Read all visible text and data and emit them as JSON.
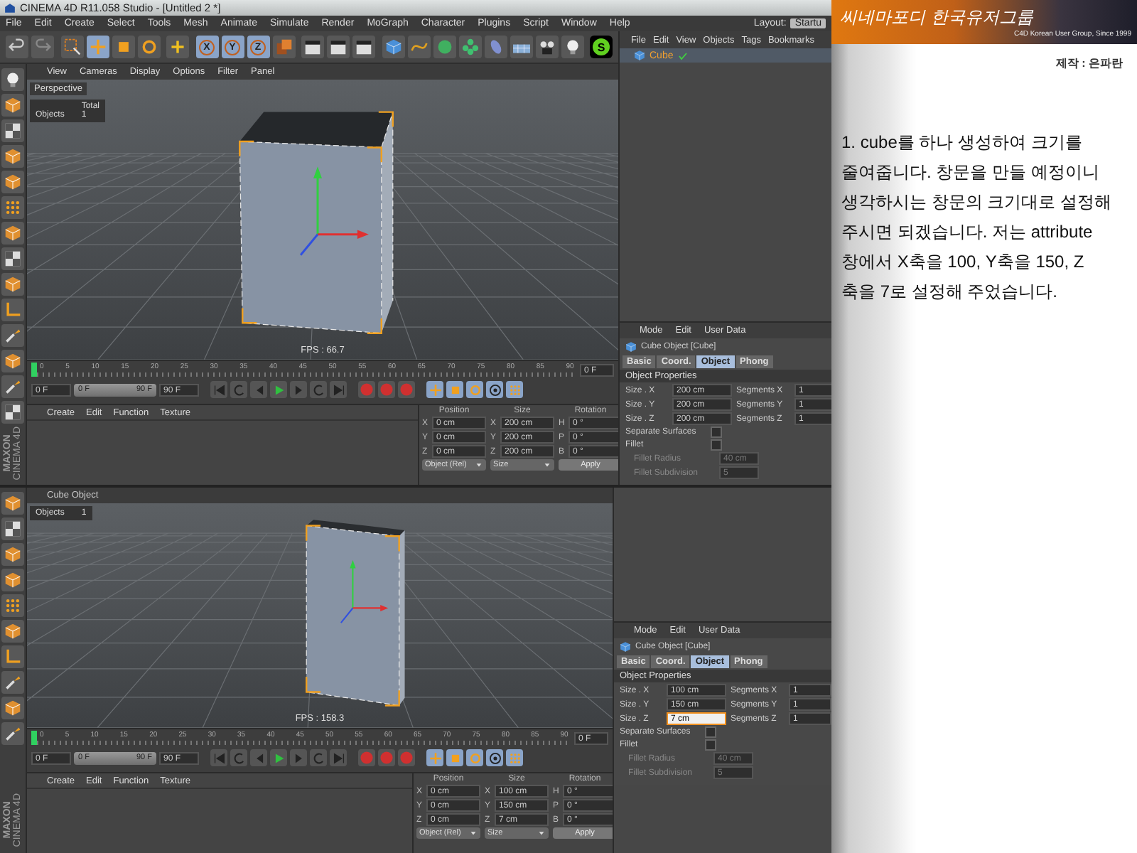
{
  "window": {
    "title": "CINEMA 4D R11.058 Studio - [Untitled 2 *]"
  },
  "menu": [
    "File",
    "Edit",
    "Create",
    "Select",
    "Tools",
    "Mesh",
    "Animate",
    "Simulate",
    "Render",
    "MoGraph",
    "Character",
    "Plugins",
    "Script",
    "Window",
    "Help"
  ],
  "layout": {
    "label": "Layout:",
    "value": "Startu"
  },
  "toolbar": {
    "axes": [
      "X",
      "Y",
      "Z"
    ],
    "script_badge": "S"
  },
  "object_manager": {
    "menu": [
      "File",
      "Edit",
      "View",
      "Objects",
      "Tags",
      "Bookmarks"
    ],
    "objects": [
      {
        "name": "Cube",
        "selected": true
      }
    ]
  },
  "screens": [
    {
      "viewport": {
        "menu": [
          "View",
          "Cameras",
          "Display",
          "Options",
          "Filter",
          "Panel"
        ],
        "camera": "Perspective",
        "stats_heading": "Total",
        "stats_label": "Objects",
        "stats_value": "1",
        "fps": "FPS : 66.7",
        "kind": "box"
      },
      "brand": [
        "MAXON",
        "CINEMA 4D"
      ],
      "timeline": {
        "ticks": [
          "0",
          "5",
          "10",
          "15",
          "20",
          "25",
          "30",
          "35",
          "40",
          "45",
          "50",
          "55",
          "60",
          "65",
          "70",
          "75",
          "80",
          "85",
          "90"
        ],
        "frame": "0 F",
        "start": "0 F",
        "range_start": "0 F",
        "range_end": "90 F",
        "level": 1,
        "end": "90 F"
      },
      "materials": {
        "menu": [
          "Create",
          "Edit",
          "Function",
          "Texture"
        ]
      },
      "coordinates": {
        "headings": [
          "Position",
          "Size",
          "Rotation"
        ],
        "rows": [
          {
            "axis": "X",
            "position": "0 cm",
            "size_axis": "X",
            "size": "200 cm",
            "rot_axis": "H",
            "rotation": "0 °"
          },
          {
            "axis": "Y",
            "position": "0 cm",
            "size_axis": "Y",
            "size": "200 cm",
            "rot_axis": "P",
            "rotation": "0 °"
          },
          {
            "axis": "Z",
            "position": "0 cm",
            "size_axis": "Z",
            "size": "200 cm",
            "rot_axis": "B",
            "rotation": "0 °"
          }
        ],
        "mode": "Object (Rel)",
        "size_mode": "Size",
        "apply": "Apply"
      },
      "attributes": {
        "menu": [
          "Mode",
          "Edit",
          "User Data"
        ],
        "title": "Cube Object [Cube]",
        "tabs": [
          {
            "label": "Basic",
            "selected": false
          },
          {
            "label": "Coord.",
            "selected": false
          },
          {
            "label": "Object",
            "selected": true
          },
          {
            "label": "Phong",
            "selected": false
          }
        ],
        "group": "Object Properties",
        "rows": [
          {
            "size_label": "Size . X",
            "size": "200 cm",
            "focused": false,
            "seg_label": "Segments X",
            "segments": "1"
          },
          {
            "size_label": "Size . Y",
            "size": "200 cm",
            "focused": false,
            "seg_label": "Segments Y",
            "segments": "1"
          },
          {
            "size_label": "Size . Z",
            "size": "200 cm",
            "focused": false,
            "seg_label": "Segments Z",
            "segments": "1"
          }
        ],
        "options": [
          {
            "label": "Separate Surfaces",
            "checked": false
          },
          {
            "label": "Fillet",
            "checked": false
          }
        ],
        "fillet": [
          {
            "label": "Fillet Radius",
            "value": "40 cm",
            "disabled": true
          },
          {
            "label": "Fillet Subdivision",
            "value": "5",
            "disabled": true
          }
        ]
      }
    },
    {
      "viewport": {
        "title": "Cube Object",
        "stats_label": "Objects",
        "stats_value": "1",
        "fps": "FPS : 158.3",
        "kind": "slab"
      },
      "brand": [
        "MAXON",
        "CINEMA 4D"
      ],
      "timeline": {
        "ticks": [
          "0",
          "5",
          "10",
          "15",
          "20",
          "25",
          "30",
          "35",
          "40",
          "45",
          "50",
          "55",
          "60",
          "65",
          "70",
          "75",
          "80",
          "85",
          "90"
        ],
        "frame": "0 F",
        "start": "0 F",
        "range_start": "0 F",
        "range_end": "90 F",
        "level": 1,
        "end": "90 F"
      },
      "materials": {
        "menu": [
          "Create",
          "Edit",
          "Function",
          "Texture"
        ]
      },
      "coordinates": {
        "headings": [
          "Position",
          "Size",
          "Rotation"
        ],
        "rows": [
          {
            "axis": "X",
            "position": "0 cm",
            "size_axis": "X",
            "size": "100 cm",
            "rot_axis": "H",
            "rotation": "0 °"
          },
          {
            "axis": "Y",
            "position": "0 cm",
            "size_axis": "Y",
            "size": "150 cm",
            "rot_axis": "P",
            "rotation": "0 °"
          },
          {
            "axis": "Z",
            "position": "0 cm",
            "size_axis": "Z",
            "size": "7 cm",
            "rot_axis": "B",
            "rotation": "0 °"
          }
        ],
        "mode": "Object (Rel)",
        "size_mode": "Size",
        "apply": "Apply"
      },
      "attributes": {
        "menu": [
          "Mode",
          "Edit",
          "User Data"
        ],
        "title": "Cube Object [Cube]",
        "tabs": [
          {
            "label": "Basic",
            "selected": false
          },
          {
            "label": "Coord.",
            "selected": false
          },
          {
            "label": "Object",
            "selected": true
          },
          {
            "label": "Phong",
            "selected": false
          }
        ],
        "group": "Object Properties",
        "rows": [
          {
            "size_label": "Size . X",
            "size": "100 cm",
            "focused": false,
            "seg_label": "Segments X",
            "segments": "1"
          },
          {
            "size_label": "Size . Y",
            "size": "150 cm",
            "focused": false,
            "seg_label": "Segments Y",
            "segments": "1"
          },
          {
            "size_label": "Size . Z",
            "size": "7 cm",
            "focused": true,
            "seg_label": "Segments Z",
            "segments": "1"
          }
        ],
        "options": [
          {
            "label": "Separate Surfaces",
            "checked": false
          },
          {
            "label": "Fillet",
            "checked": false
          }
        ],
        "fillet": [
          {
            "label": "Fillet Radius",
            "value": "40 cm",
            "disabled": true
          },
          {
            "label": "Fillet Subdivision",
            "value": "5",
            "disabled": true
          }
        ]
      }
    }
  ],
  "tutorial": {
    "logo": "씨네마포디 한국유저그룹",
    "subtitle": "C4D Korean User Group, Since 1999",
    "credit": "제작 : 은파란",
    "text": "1. cube를 하나 생성하여 크기를\n줄여줍니다. 창문을 만들 예정이니\n생각하시는 창문의 크기대로 설정해\n주시면 되겠습니다. 저는 attribute\n창에서 X축을 100, Y축을 150, Z\n축을 7로 설정해 주었습니다."
  }
}
